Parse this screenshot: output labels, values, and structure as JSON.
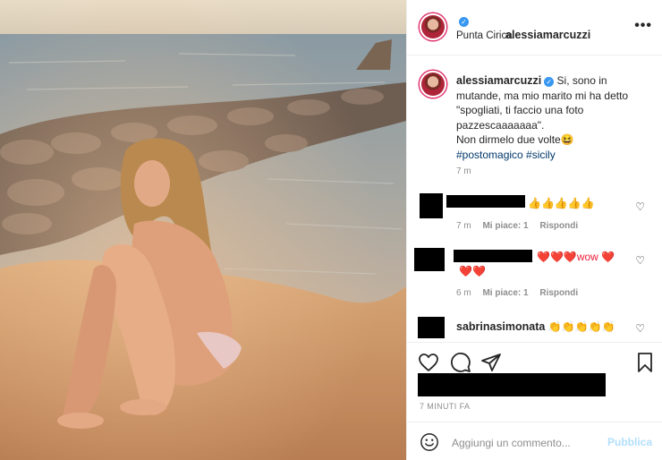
{
  "post": {
    "username": "alessiamarcuzzi",
    "location": "Punta Cirica",
    "verified_mark": "✓",
    "more": "•••"
  },
  "caption": {
    "username": "alessiamarcuzzi",
    "line1": "Si, sono in mutande, ma mio marito mi ha detto \"spogliati, ti faccio una foto pazzescaaaaaaa\".",
    "line2": "Non dirmelo due volte😆",
    "hashtags": "#postomagico #sicily",
    "time": "7 m"
  },
  "comments": [
    {
      "text": "👍👍👍👍👍",
      "time": "7 m",
      "likes": "Mi piace: 1",
      "reply": "Rispondi"
    },
    {
      "text": "❤️❤️❤️wow ❤️",
      "text2": "❤️❤️",
      "time": "6 m",
      "likes": "Mi piace: 1",
      "reply": "Rispondi"
    },
    {
      "username": "sabrinasimonata",
      "text": "👏👏👏👏👏"
    }
  ],
  "actions": {
    "time_ago": "7 MINUTI FA",
    "comment_placeholder": "Aggiungi un commento...",
    "publish_label": "Pubblica"
  },
  "icons": {
    "like": "heart-outline-icon",
    "comment": "comment-bubble-icon",
    "share": "paper-plane-icon",
    "save": "bookmark-icon",
    "emoji": "smiley-icon",
    "comment_like": "heart-icon"
  },
  "colors": {
    "verified": "#3897f0",
    "link": "#00376b",
    "muted": "#8e8e8e",
    "publish_disabled": "#b2dffc"
  }
}
